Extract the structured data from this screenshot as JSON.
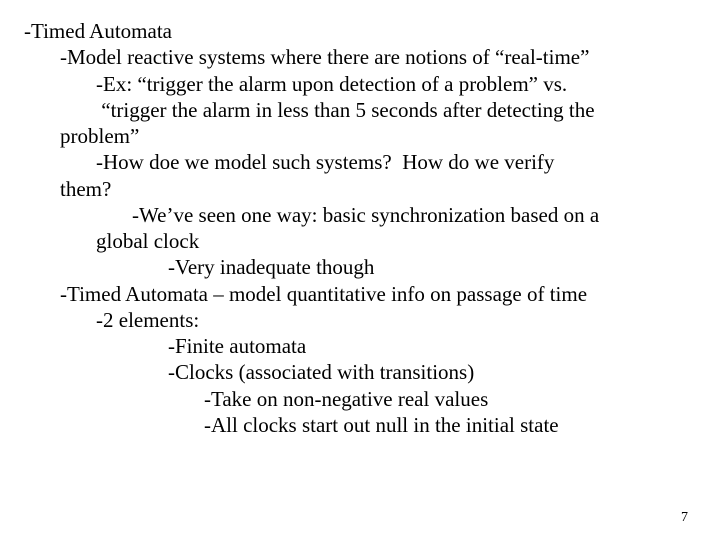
{
  "page_number": "7",
  "lines": {
    "l0": "-Timed Automata",
    "l1": "-Model reactive systems where there are notions of “real-time”",
    "l2": "-Ex: “trigger the alarm upon detection of a problem” vs.",
    "l3": " “trigger the alarm in less than 5 seconds after detecting the",
    "l4": "problem”",
    "l5": "-How doe we model such systems?  How do we verify",
    "l6": "them?",
    "l7": "-We’ve seen one way: basic synchronization based on a",
    "l8": "global clock",
    "l9": "-Very inadequate though",
    "l10": "-Timed Automata – model quantitative info on passage of time",
    "l11": "-2 elements:",
    "l12": "-Finite automata",
    "l13": "-Clocks (associated with transitions)",
    "l14": "-Take on non-negative real values",
    "l15": "-All clocks start out null in the initial state"
  }
}
